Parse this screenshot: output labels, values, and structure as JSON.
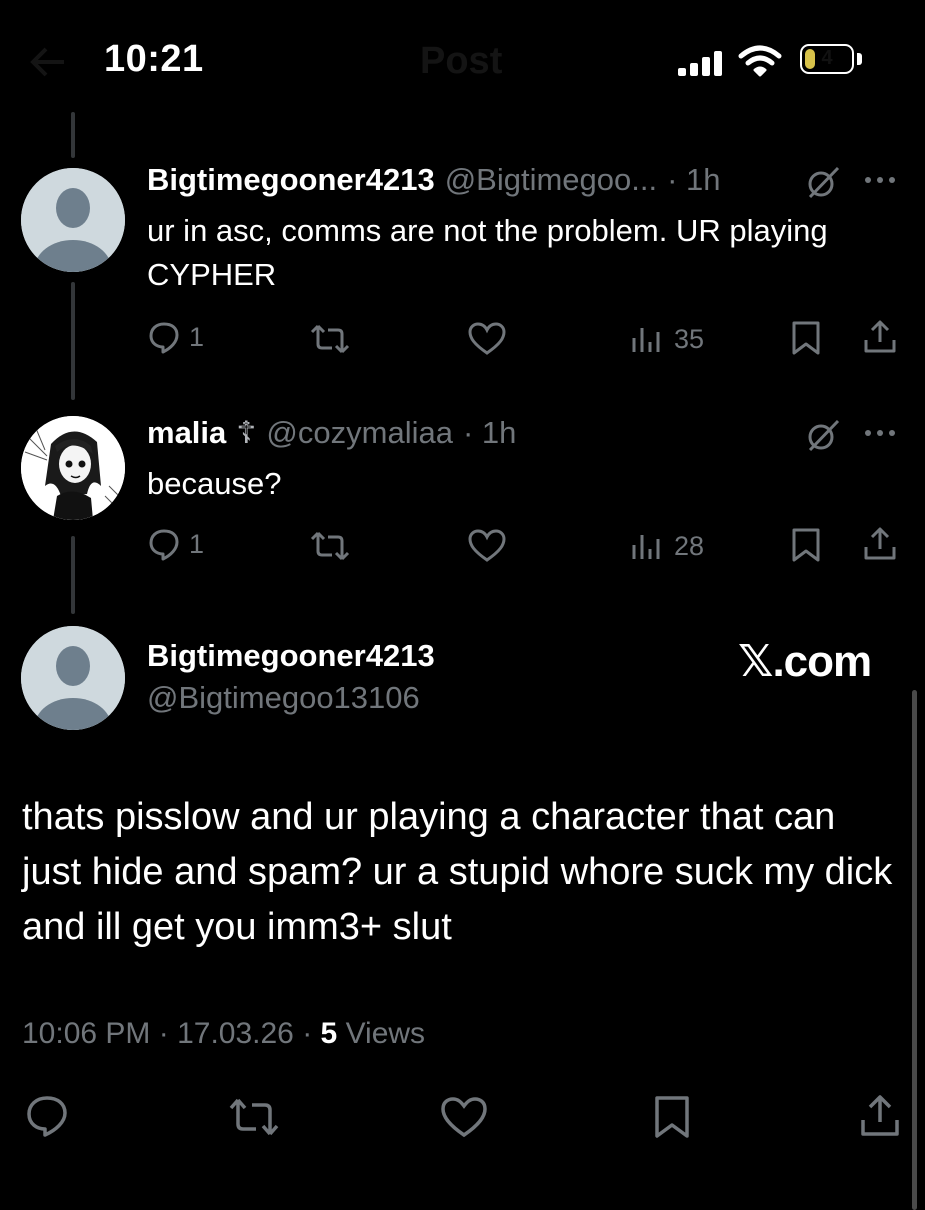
{
  "status_bar": {
    "time": "10:21",
    "battery": "4",
    "title_ghost": "Post"
  },
  "replies": [
    {
      "name": "Bigtimegooner4213",
      "handle": "@Bigtimegoo...",
      "time": "· 1h",
      "text": "ur in asc, comms are not the problem. UR playing CYPHER",
      "reply_count": "1",
      "views": "35"
    },
    {
      "name": "malia",
      "name_symbol": "☦",
      "handle": "@cozymaliaa",
      "time": "· 1h",
      "text": "because?",
      "reply_count": "1",
      "views": "28"
    }
  ],
  "main_post": {
    "name": "Bigtimegooner4213",
    "handle": "@Bigtimegoo13106",
    "text": "thats pisslow and ur playing a character that can just hide and spam? ur a stupid whore suck my dick and ill get you imm3+ slut",
    "time": "10:06 PM",
    "date": "17.03.26",
    "views_count": "5",
    "views_label": "Views"
  },
  "watermark": "𝕏.com",
  "colors": {
    "background": "#000000",
    "text": "#e7e9ea",
    "secondary": "#71767b",
    "avatar_default": "#cfd9de",
    "avatar_silhouette": "#6e7f8d"
  },
  "icons": [
    "back-arrow-icon",
    "signal-icon",
    "wifi-icon",
    "battery-icon",
    "grok-icon",
    "more-icon",
    "reply-icon",
    "repost-icon",
    "like-icon",
    "views-icon",
    "bookmark-icon",
    "share-icon"
  ]
}
